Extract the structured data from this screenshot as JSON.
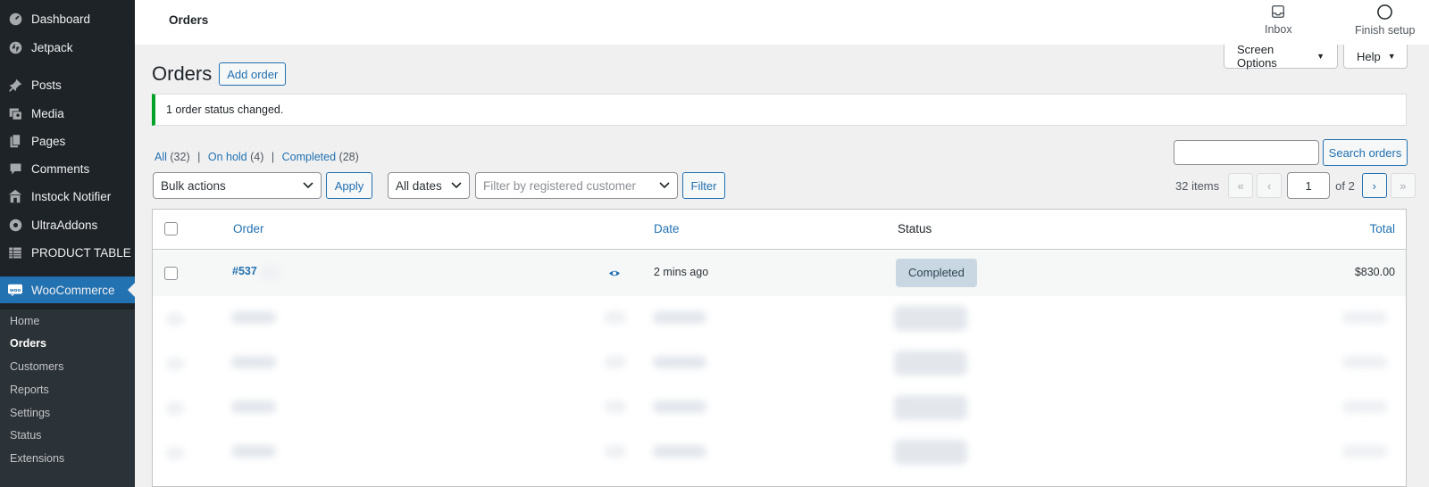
{
  "sidebar": {
    "items": [
      {
        "label": "Dashboard",
        "icon": "dashboard-icon"
      },
      {
        "label": "Jetpack",
        "icon": "jetpack-icon"
      },
      {
        "label": "Posts",
        "icon": "pin-icon"
      },
      {
        "label": "Media",
        "icon": "media-icon"
      },
      {
        "label": "Pages",
        "icon": "pages-icon"
      },
      {
        "label": "Comments",
        "icon": "comment-icon"
      },
      {
        "label": "Instock Notifier",
        "icon": "store-icon"
      },
      {
        "label": "UltraAddons",
        "icon": "addons-icon"
      },
      {
        "label": "PRODUCT TABLE",
        "icon": "table-icon"
      },
      {
        "label": "WooCommerce",
        "icon": "woo-icon"
      }
    ],
    "submenu": [
      "Home",
      "Orders",
      "Customers",
      "Reports",
      "Settings",
      "Status",
      "Extensions"
    ],
    "active_color": "#2271b1"
  },
  "header": {
    "page_heading": "Orders",
    "inbox_label": "Inbox",
    "finish_setup_label": "Finish setup"
  },
  "screen_options_label": "Screen Options",
  "help_label": "Help",
  "title": "Orders",
  "add_order_label": "Add order",
  "notice_text": "1 order status changed.",
  "notice_color": "#00a32a",
  "views": {
    "all_label": "All",
    "all_count": "(32)",
    "onhold_label": "On hold",
    "onhold_count": "(4)",
    "completed_label": "Completed",
    "completed_count": "(28)",
    "separator": "|"
  },
  "filters": {
    "bulk_actions": "Bulk actions",
    "apply_label": "Apply",
    "dates": "All dates",
    "customer_placeholder": "Filter by registered customer",
    "filter_label": "Filter"
  },
  "search": {
    "button_label": "Search orders"
  },
  "pagination": {
    "items_text": "32 items",
    "first": "«",
    "prev": "‹",
    "current_page": "1",
    "of_text": "of 2",
    "next": "›",
    "last": "»"
  },
  "table": {
    "columns": [
      "Order",
      "Date",
      "Status",
      "Total"
    ],
    "rows": [
      {
        "order": "#537",
        "date": "2 mins ago",
        "status": "Completed",
        "total": "$830.00"
      }
    ],
    "status_color": "#c8d7e1"
  }
}
